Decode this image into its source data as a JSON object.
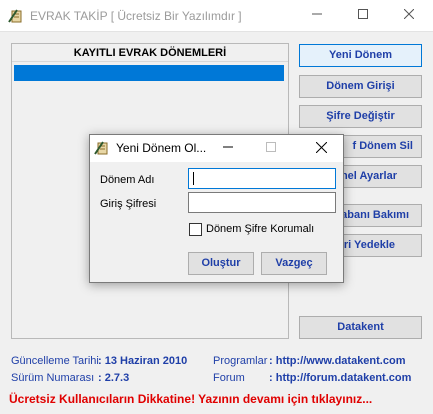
{
  "window": {
    "title": "EVRAK TAKİP [ Ücretsiz Bir Yazılımdır ]"
  },
  "list": {
    "header": "KAYITLI EVRAK DÖNEMLERİ"
  },
  "side_buttons": {
    "yeni_donem": "Yeni Dönem",
    "donem_girisi": "Dönem Girişi",
    "sifre_degistir": "Şifre Değiştir",
    "donem_sil": "f Dönem Sil",
    "ayarlar": "nel Ayarlar",
    "veritabani_bakimi": "abanı Bakımı",
    "yedekle": "ri Yedekle",
    "datakent": "Datakent"
  },
  "info": {
    "update_label": "Güncelleme Tarihi",
    "update_value": ": 13 Haziran 2010",
    "version_label": "Sürüm Numarası",
    "version_value": ": 2.7.3",
    "programs_label": "Programlar",
    "programs_value": ": http://www.datakent.com",
    "forum_label": "Forum",
    "forum_value": ": http://forum.datakent.com",
    "warning": "Ücretsiz Kullanıcıların Dikkatine! Yazının devamı için tıklayınız..."
  },
  "dialog": {
    "title": "Yeni Dönem Ol...",
    "period_name_label": "Dönem Adı",
    "period_name_value": "",
    "password_label": "Giriş Şifresi",
    "password_value": "",
    "protect_label": "Dönem Şifre Korumalı",
    "create_button": "Oluştur",
    "cancel_button": "Vazgeç"
  },
  "colors": {
    "link_blue": "#1f3fa8",
    "warning_red": "#e00000",
    "selection": "#0078d7"
  },
  "icons": {
    "app": "document-pen-icon",
    "minimize": "minimize-icon",
    "maximize": "maximize-icon",
    "close": "close-icon"
  }
}
